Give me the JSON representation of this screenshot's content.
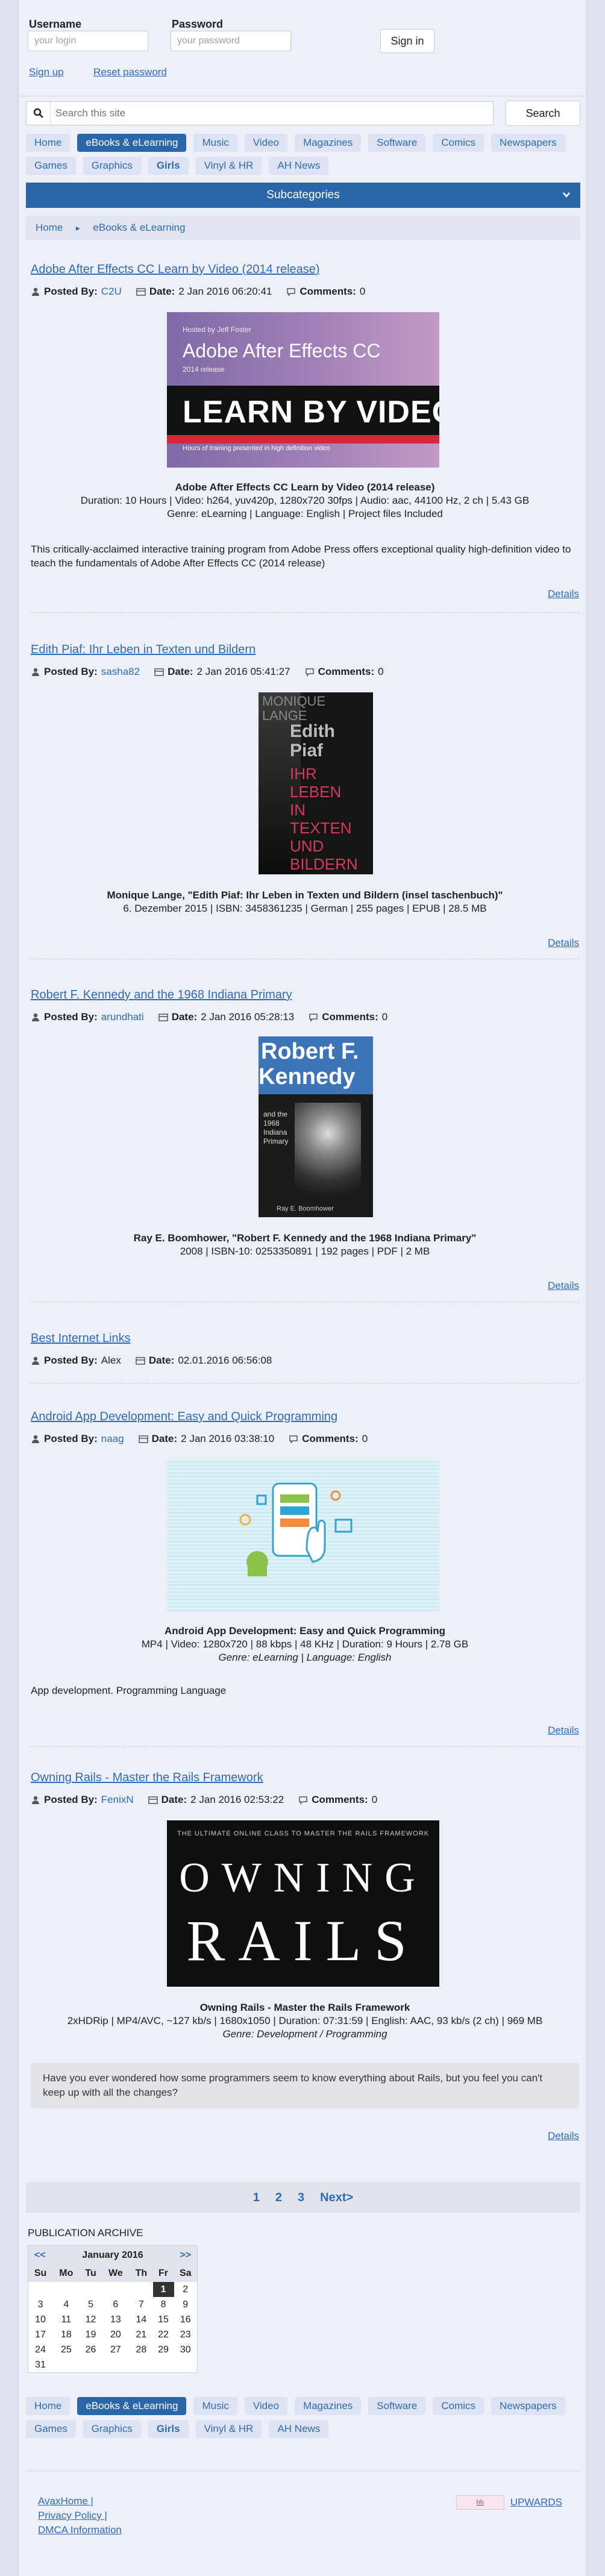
{
  "login": {
    "username_label": "Username",
    "username_placeholder": "your login",
    "password_label": "Password",
    "password_placeholder": "your password",
    "signin_label": "Sign in",
    "signup_label": "Sign up",
    "reset_label": "Reset password"
  },
  "search": {
    "placeholder": "Search this site",
    "button_label": "Search"
  },
  "categories": [
    {
      "label": "Home",
      "active": false
    },
    {
      "label": "eBooks & eLearning",
      "active": true
    },
    {
      "label": "Music",
      "active": false
    },
    {
      "label": "Video",
      "active": false
    },
    {
      "label": "Magazines",
      "active": false
    },
    {
      "label": "Software",
      "active": false
    },
    {
      "label": "Comics",
      "active": false
    },
    {
      "label": "Newspapers",
      "active": false
    },
    {
      "label": "Games",
      "active": false
    },
    {
      "label": "Graphics",
      "active": false
    },
    {
      "label": "Girls",
      "active": false
    },
    {
      "label": "Vinyl & HR",
      "active": false
    },
    {
      "label": "AH News",
      "active": false
    }
  ],
  "subcategories_label": "Subcategories",
  "breadcrumb": {
    "home": "Home",
    "section": "eBooks & eLearning"
  },
  "meta_labels": {
    "posted_by": "Posted By:",
    "date": "Date:",
    "comments": "Comments:"
  },
  "details_label": "Details",
  "posts": [
    {
      "title": "Adobe After Effects CC Learn by Video (2014 release)",
      "author": "C2U",
      "date": "2 Jan 2016 06:20:41",
      "comments": "0",
      "cover": {
        "line1": "Hosted by Jeff Foster",
        "line2": "Adobe After Effects CC",
        "line3": "2014 release",
        "line4": "LEARN BY VIDEO",
        "line5": "Hours of training presented in high definition video"
      },
      "caption_title": "Adobe After Effects CC Learn by Video (2014 release)",
      "caption_lines": [
        "Duration: 10 Hours | Video: h264, yuv420p, 1280x720 30fps | Audio: aac, 44100 Hz, 2 ch | 5.43 GB",
        "Genre: eLearning | Language: English | Project files Included"
      ],
      "description": "This critically-acclaimed interactive training program from Adobe Press offers exceptional quality high-definition video to teach the fundamentals of Adobe After Effects CC (2014 release)"
    },
    {
      "title": "Edith Piaf: Ihr Leben in Texten und Bildern",
      "author": "sasha82",
      "date": "2 Jan 2016 05:41:27",
      "comments": "0",
      "cover": {
        "line1": "MONIQUE",
        "line2": "LANGE",
        "line3": "Edith",
        "line4": "Piaf",
        "line5": "IHR\nLEBEN\nIN\nTEXTEN\nUND\nBILDERN"
      },
      "caption_title": "Monique Lange, \"Edith Piaf: Ihr Leben in Texten und Bildern (insel taschenbuch)\"",
      "caption_lines": [
        "6. Dezember 2015 | ISBN: 3458361235 | German | 255 pages | EPUB | 28.5 MB"
      ]
    },
    {
      "title": "Robert F. Kennedy and the 1968 Indiana Primary",
      "author": "arundhati",
      "date": "2 Jan 2016 05:28:13",
      "comments": "0",
      "cover": {
        "line1": "Robert F.",
        "line2": "Kennedy",
        "line3": "and the\n1968\nIndiana\nPrimary",
        "line4": "Ray E. Boomhower"
      },
      "caption_title": "Ray E. Boomhower, \"Robert F. Kennedy and the 1968 Indiana Primary\"",
      "caption_lines": [
        "2008 | ISBN-10: 0253350891 | 192 pages | PDF | 2 MB"
      ]
    },
    {
      "title": "Best Internet Links",
      "author": "Alex",
      "date": "02.01.2016 06:56:08"
    },
    {
      "title": "Android App Development: Easy and Quick Programming",
      "author": "naag",
      "date": "2 Jan 2016 03:38:10",
      "comments": "0",
      "caption_title": "Android App Development: Easy and Quick Programming",
      "caption_lines": [
        "MP4 | Video: 1280x720 | 88 kbps | 48 KHz | Duration: 9 Hours | 2.78 GB"
      ],
      "caption_italic": "Genre: eLearning | Language: English",
      "description": "App development. Programming Language"
    },
    {
      "title": "Owning Rails - Master the Rails Framework",
      "author": "FenixN",
      "date": "2 Jan 2016 02:53:22",
      "comments": "0",
      "cover": {
        "line1": "THE ULTIMATE ONLINE CLASS TO MASTER THE RAILS FRAMEWORK",
        "line2": "OWNING",
        "line3": "RAILS"
      },
      "caption_title": "Owning Rails - Master the Rails Framework",
      "caption_lines": [
        "2xHDRip | MP4/AVC, ~127 kb/s | 1680x1050 | Duration: 07:31:59 | English: AAC, 93 kb/s (2 ch) | 969 MB"
      ],
      "caption_italic": "Genre: Development / Programming",
      "quote": "Have you ever wondered how some programmers seem to know everything about Rails, but you feel you can't keep up with all the changes?"
    }
  ],
  "pager": {
    "p1": "1",
    "p2": "2",
    "p3": "3",
    "next": "Next>"
  },
  "archive": {
    "title": "PUBLICATION ARCHIVE",
    "prev": "<<",
    "next": ">>",
    "month": "January 2016",
    "weekdays": [
      "Su",
      "Mo",
      "Tu",
      "We",
      "Th",
      "Fr",
      "Sa"
    ],
    "weeks": [
      [
        "",
        "",
        "",
        "",
        "",
        "1",
        "2"
      ],
      [
        "3",
        "4",
        "5",
        "6",
        "7",
        "8",
        "9"
      ],
      [
        "10",
        "11",
        "12",
        "13",
        "14",
        "15",
        "16"
      ],
      [
        "17",
        "18",
        "19",
        "20",
        "21",
        "22",
        "23"
      ],
      [
        "24",
        "25",
        "26",
        "27",
        "28",
        "29",
        "30"
      ],
      [
        "31",
        "",
        "",
        "",
        "",
        "",
        ""
      ]
    ],
    "today": "1"
  },
  "footer": {
    "site": "AvaxHome |",
    "privacy": "Privacy Policy |",
    "dmca": "DMCA Information",
    "upwards": "UPWARDS",
    "upwards_badge": "hh"
  }
}
